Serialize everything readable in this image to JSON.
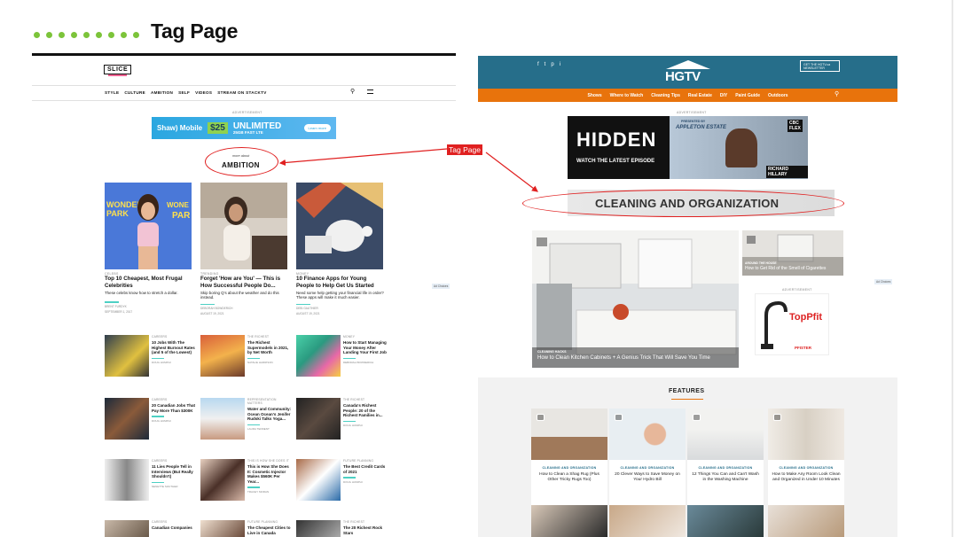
{
  "slide": {
    "title": "Tag Page"
  },
  "annotation": {
    "tag_label": "Tag Page"
  },
  "slice": {
    "logo": "SLICE",
    "nav": [
      "STYLE",
      "CULTURE",
      "AMBITION",
      "SELF",
      "VIDEOS",
      "STREAM ON STACKTV"
    ],
    "advertisement_label": "ADVERTISEMENT",
    "ad": {
      "brand": "Shaw) Mobile",
      "price": "$25",
      "line1": "UNLIMITED",
      "line2": "25GB FAST LTE",
      "cta": "Learn more"
    },
    "more_about": "more about",
    "tag": "AMBITION",
    "featured": [
      {
        "category": "CELEBS",
        "title": "Top 10 Cheapest, Most Frugal Celebrities",
        "desc": "These celebs know how to stretch a dollar.",
        "author": "BRENT FURDYK",
        "date": "SEPTEMBER 1, 2017"
      },
      {
        "category": "TRENDING",
        "title": "Forget 'How are You' — This is How Successful People Do...",
        "desc": "Skip boring Q's about the weather and do this instead.",
        "author": "DEBORAH BOWDERICH",
        "date": "AUGUST 19, 2021"
      },
      {
        "category": "MONEY",
        "title": "10 Finance Apps for Young People to Help Get Us Started",
        "desc": "Need some help getting your financial life in order? These apps will make it much easier.",
        "author": "DEBI GAUTHIER",
        "date": "AUGUST 19, 2021"
      }
    ],
    "ad_choices": "Ad Choices",
    "rows": [
      [
        {
          "category": "CAREERS",
          "title": "10 Jobs With The Highest Burnout Rates (and 5 of the Lowest)",
          "author": "DOUG HUMPHI"
        },
        {
          "category": "THE RICHEST",
          "title": "The Richest Supermodels in 2021, by Net Worth",
          "author": "NATALIE HARRISON"
        },
        {
          "category": "MONEY",
          "title": "How to Start Managing Your Money After Landing Your First Job",
          "author": "DEBORAH BOWDERICH"
        }
      ],
      [
        {
          "category": "CAREERS",
          "title": "20 Canadian Jobs That Pay More Than $300K",
          "author": "DOUG HUMPHI"
        },
        {
          "category": "REPRESENTATION MATTERS",
          "title": "Water and Community: Ocean Ocean's Jenifer Rudski Talks Yoga...",
          "author": "LAURA TENNENT"
        },
        {
          "category": "THE RICHEST",
          "title": "Canada's Richest People: 20 of the Richest Families in...",
          "author": "DOUG HUMPHI"
        }
      ],
      [
        {
          "category": "CAREERS",
          "title": "11 Lies People Tell in Interviews (But Really Shouldn't)",
          "author": "NENETTE SOUTHER"
        },
        {
          "category": "THIS IS HOW SHE DOES IT",
          "title": "This is How She Does It: Cosmetic Injector Makes $560K Per Year...",
          "author": "TRACEY MORAN"
        },
        {
          "category": "FUTURE PLANNING",
          "title": "The Best Credit Cards of 2021",
          "author": "DOUG HUMPHI"
        }
      ],
      [
        {
          "category": "CAREERS",
          "title": "Canadian Companies",
          "author": ""
        },
        {
          "category": "FUTURE PLANNING",
          "title": "The Cheapest Cities to Live in Canada",
          "author": ""
        },
        {
          "category": "THE RICHEST",
          "title": "The 20 Richest Rock Stars",
          "author": ""
        }
      ]
    ]
  },
  "hgtv": {
    "logo": "HGTV",
    "social": [
      "f",
      "t",
      "p",
      "i"
    ],
    "newsletter": "GET THE HGTV.ca NEWSLETTER",
    "nav": [
      "Shows",
      "Where to Watch",
      "Cleaning Tips",
      "Real Estate",
      "DIY",
      "Paint Guide",
      "Outdoors"
    ],
    "advertisement_label": "ADVERTISEMENT",
    "ad": {
      "title": "HIDDEN",
      "cta": "WATCH THE LATEST EPISODE",
      "presenter": "PRESENTED BY",
      "sponsor": "APPLETON ESTATE",
      "person": "RICHARD HILLARY",
      "badge1": "CBC",
      "badge2": "FLEX"
    },
    "tag": "CLEANING AND ORGANIZATION",
    "hero": {
      "category": "CLEANING HACKS",
      "title": "How to Clean Kitchen Cabinets + A Genius Trick That Will Save You Time"
    },
    "side": {
      "category": "AROUND THE HOUSE",
      "title": "How to Get Rid of the Smell of Cigarettes"
    },
    "side_ad": {
      "brand": "TopPfit",
      "sub": "PFISTER"
    },
    "ad_choices": "Ad Choices",
    "features_heading": "FEATURES",
    "features": [
      {
        "category": "CLEANING AND ORGANIZATION",
        "title": "How to Clean a Shag Rug (Plus Other Tricky Rugs Too)"
      },
      {
        "category": "CLEANING AND ORGANIZATION",
        "title": "20 Clever Ways to Save Money on Your Hydro Bill"
      },
      {
        "category": "CLEANING AND ORGANIZATION",
        "title": "12 Things You Can and Can't Wash in the Washing Machine"
      },
      {
        "category": "CLEANING AND ORGANIZATION",
        "title": "How to Make Any Room Look Clean and Organized in Under 10 Minutes"
      }
    ]
  }
}
